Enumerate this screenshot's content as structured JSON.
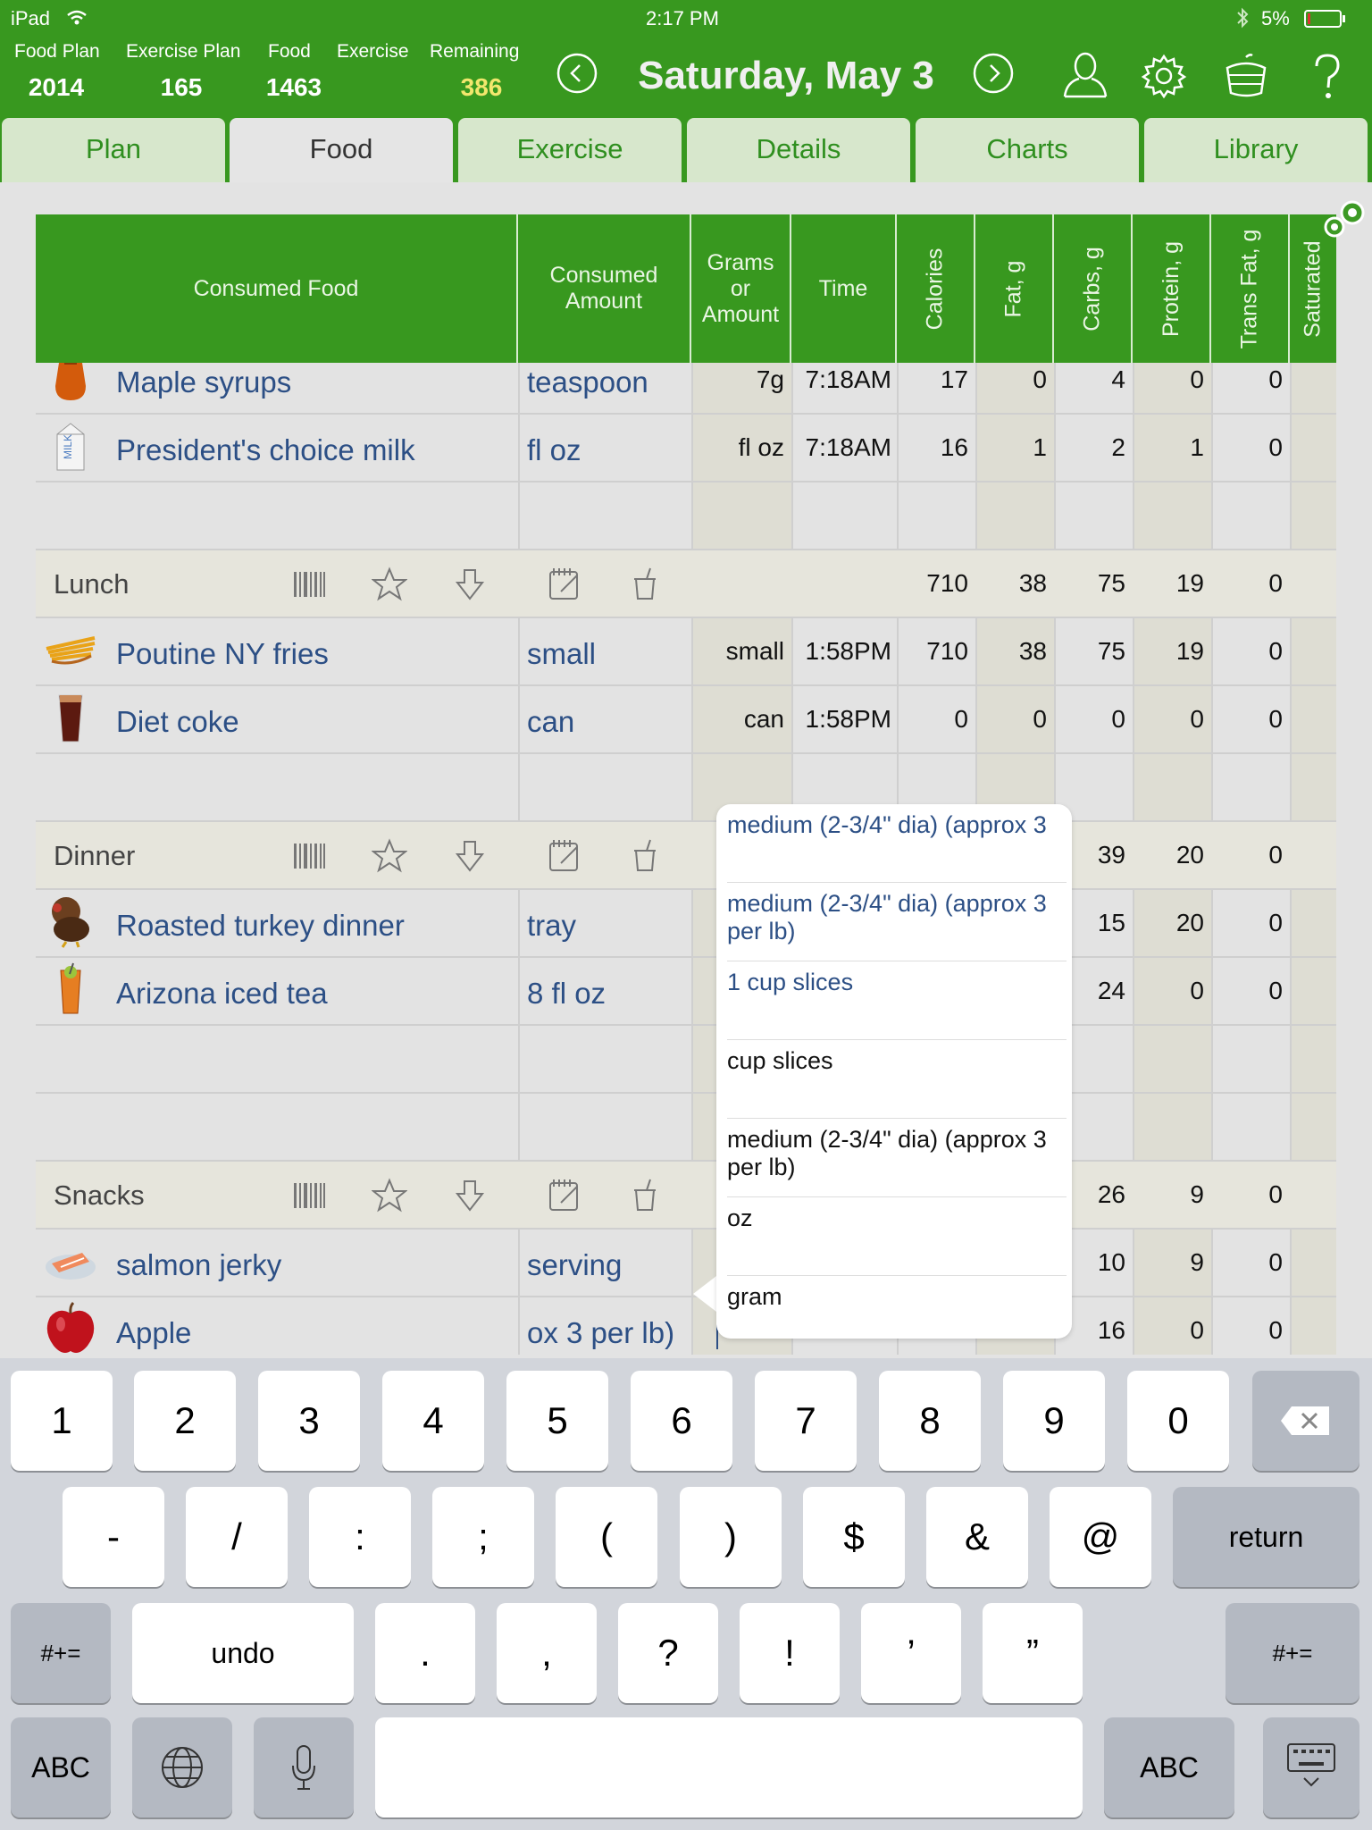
{
  "status_bar": {
    "device": "iPad",
    "time": "2:17 PM",
    "battery": "5%"
  },
  "summary": [
    {
      "label": "Food Plan",
      "value": "2014"
    },
    {
      "label": "Exercise Plan",
      "value": "165"
    },
    {
      "label": "Food",
      "value": "1463"
    },
    {
      "label": "Exercise",
      "value": ""
    },
    {
      "label": "Remaining",
      "value": "386"
    }
  ],
  "date_title": "Saturday, May 3",
  "header_icons": [
    "previous-day-icon",
    "next-day-icon",
    "profile-icon",
    "settings-icon",
    "food-scale-icon",
    "help-icon"
  ],
  "tabs": [
    "Plan",
    "Food",
    "Exercise",
    "Details",
    "Charts",
    "Library"
  ],
  "active_tab": "Food",
  "columns": [
    "Consumed Food",
    "Consumed Amount",
    "Grams or Amount",
    "Time",
    "Calories",
    "Fat, g",
    "Carbs, g",
    "Protein, g",
    "Trans Fat, g",
    "Saturated"
  ],
  "section_icons": [
    "barcode-icon",
    "favorite-star-icon",
    "download-arrow-icon",
    "notepad-icon",
    "drink-icon"
  ],
  "rows": [
    {
      "type": "food",
      "icon": "syrup-icon",
      "name": "Maple syrups",
      "amount": "teaspoon",
      "grams": "7g",
      "time": "7:18AM",
      "cal": "17",
      "fat": "0",
      "carbs": "4",
      "protein": "0",
      "trans": "0"
    },
    {
      "type": "food",
      "icon": "milk-carton-icon",
      "name": "President's choice milk",
      "amount": "fl oz",
      "grams": "fl oz",
      "time": "7:18AM",
      "cal": "16",
      "fat": "1",
      "carbs": "2",
      "protein": "1",
      "trans": "0"
    },
    {
      "type": "empty"
    },
    {
      "type": "section",
      "name": "Lunch",
      "cal": "710",
      "fat": "38",
      "carbs": "75",
      "protein": "19",
      "trans": "0"
    },
    {
      "type": "food",
      "icon": "fries-icon",
      "name": "Poutine NY fries",
      "amount": "small",
      "grams": "small",
      "time": "1:58PM",
      "cal": "710",
      "fat": "38",
      "carbs": "75",
      "protein": "19",
      "trans": "0"
    },
    {
      "type": "food",
      "icon": "cola-glass-icon",
      "name": "Diet coke",
      "amount": "can",
      "grams": "can",
      "time": "1:58PM",
      "cal": "0",
      "fat": "0",
      "carbs": "0",
      "protein": "0",
      "trans": "0"
    },
    {
      "type": "empty"
    },
    {
      "type": "section",
      "name": "Dinner",
      "carbs": "39",
      "protein": "20",
      "trans": "0"
    },
    {
      "type": "food",
      "icon": "turkey-icon",
      "name": "Roasted turkey dinner",
      "amount": "tray",
      "carbs": "15",
      "protein": "20",
      "trans": "0"
    },
    {
      "type": "food",
      "icon": "iced-tea-icon",
      "name": "Arizona iced tea",
      "amount": "8 fl oz",
      "carbs": "24",
      "protein": "0",
      "trans": "0"
    },
    {
      "type": "empty"
    },
    {
      "type": "empty"
    },
    {
      "type": "section",
      "name": "Snacks",
      "carbs": "26",
      "protein": "9",
      "trans": "0"
    },
    {
      "type": "food",
      "icon": "salmon-icon",
      "name": "salmon jerky",
      "amount": "serving",
      "carbs": "10",
      "protein": "9",
      "trans": "0"
    },
    {
      "type": "food",
      "icon": "apple-icon",
      "name": "Apple",
      "amount": "ox 3 per lb)",
      "carbs": "16",
      "protein": "0",
      "trans": "0"
    }
  ],
  "popover_options": [
    {
      "label": "medium (2-3/4\" dia) (approx 3",
      "style": "blue"
    },
    {
      "label": "medium (2-3/4\" dia) (approx 3 per lb)",
      "style": "blue"
    },
    {
      "label": "1 cup slices",
      "style": "blue"
    },
    {
      "label": "cup slices",
      "style": "black"
    },
    {
      "label": "medium (2-3/4\" dia) (approx 3 per lb)",
      "style": "black"
    },
    {
      "label": "oz",
      "style": "black"
    },
    {
      "label": "gram",
      "style": "black"
    }
  ],
  "keyboard": {
    "row1": [
      "1",
      "2",
      "3",
      "4",
      "5",
      "6",
      "7",
      "8",
      "9",
      "0"
    ],
    "row2": [
      "-",
      "/",
      ":",
      ";",
      "(",
      ")",
      "$",
      "&",
      "@"
    ],
    "return_label": "return",
    "row3": [
      ".",
      ",",
      "?",
      "!",
      "’",
      "”"
    ],
    "undo_label": "undo",
    "shift_label": "#+=",
    "abc_label": "ABC"
  }
}
